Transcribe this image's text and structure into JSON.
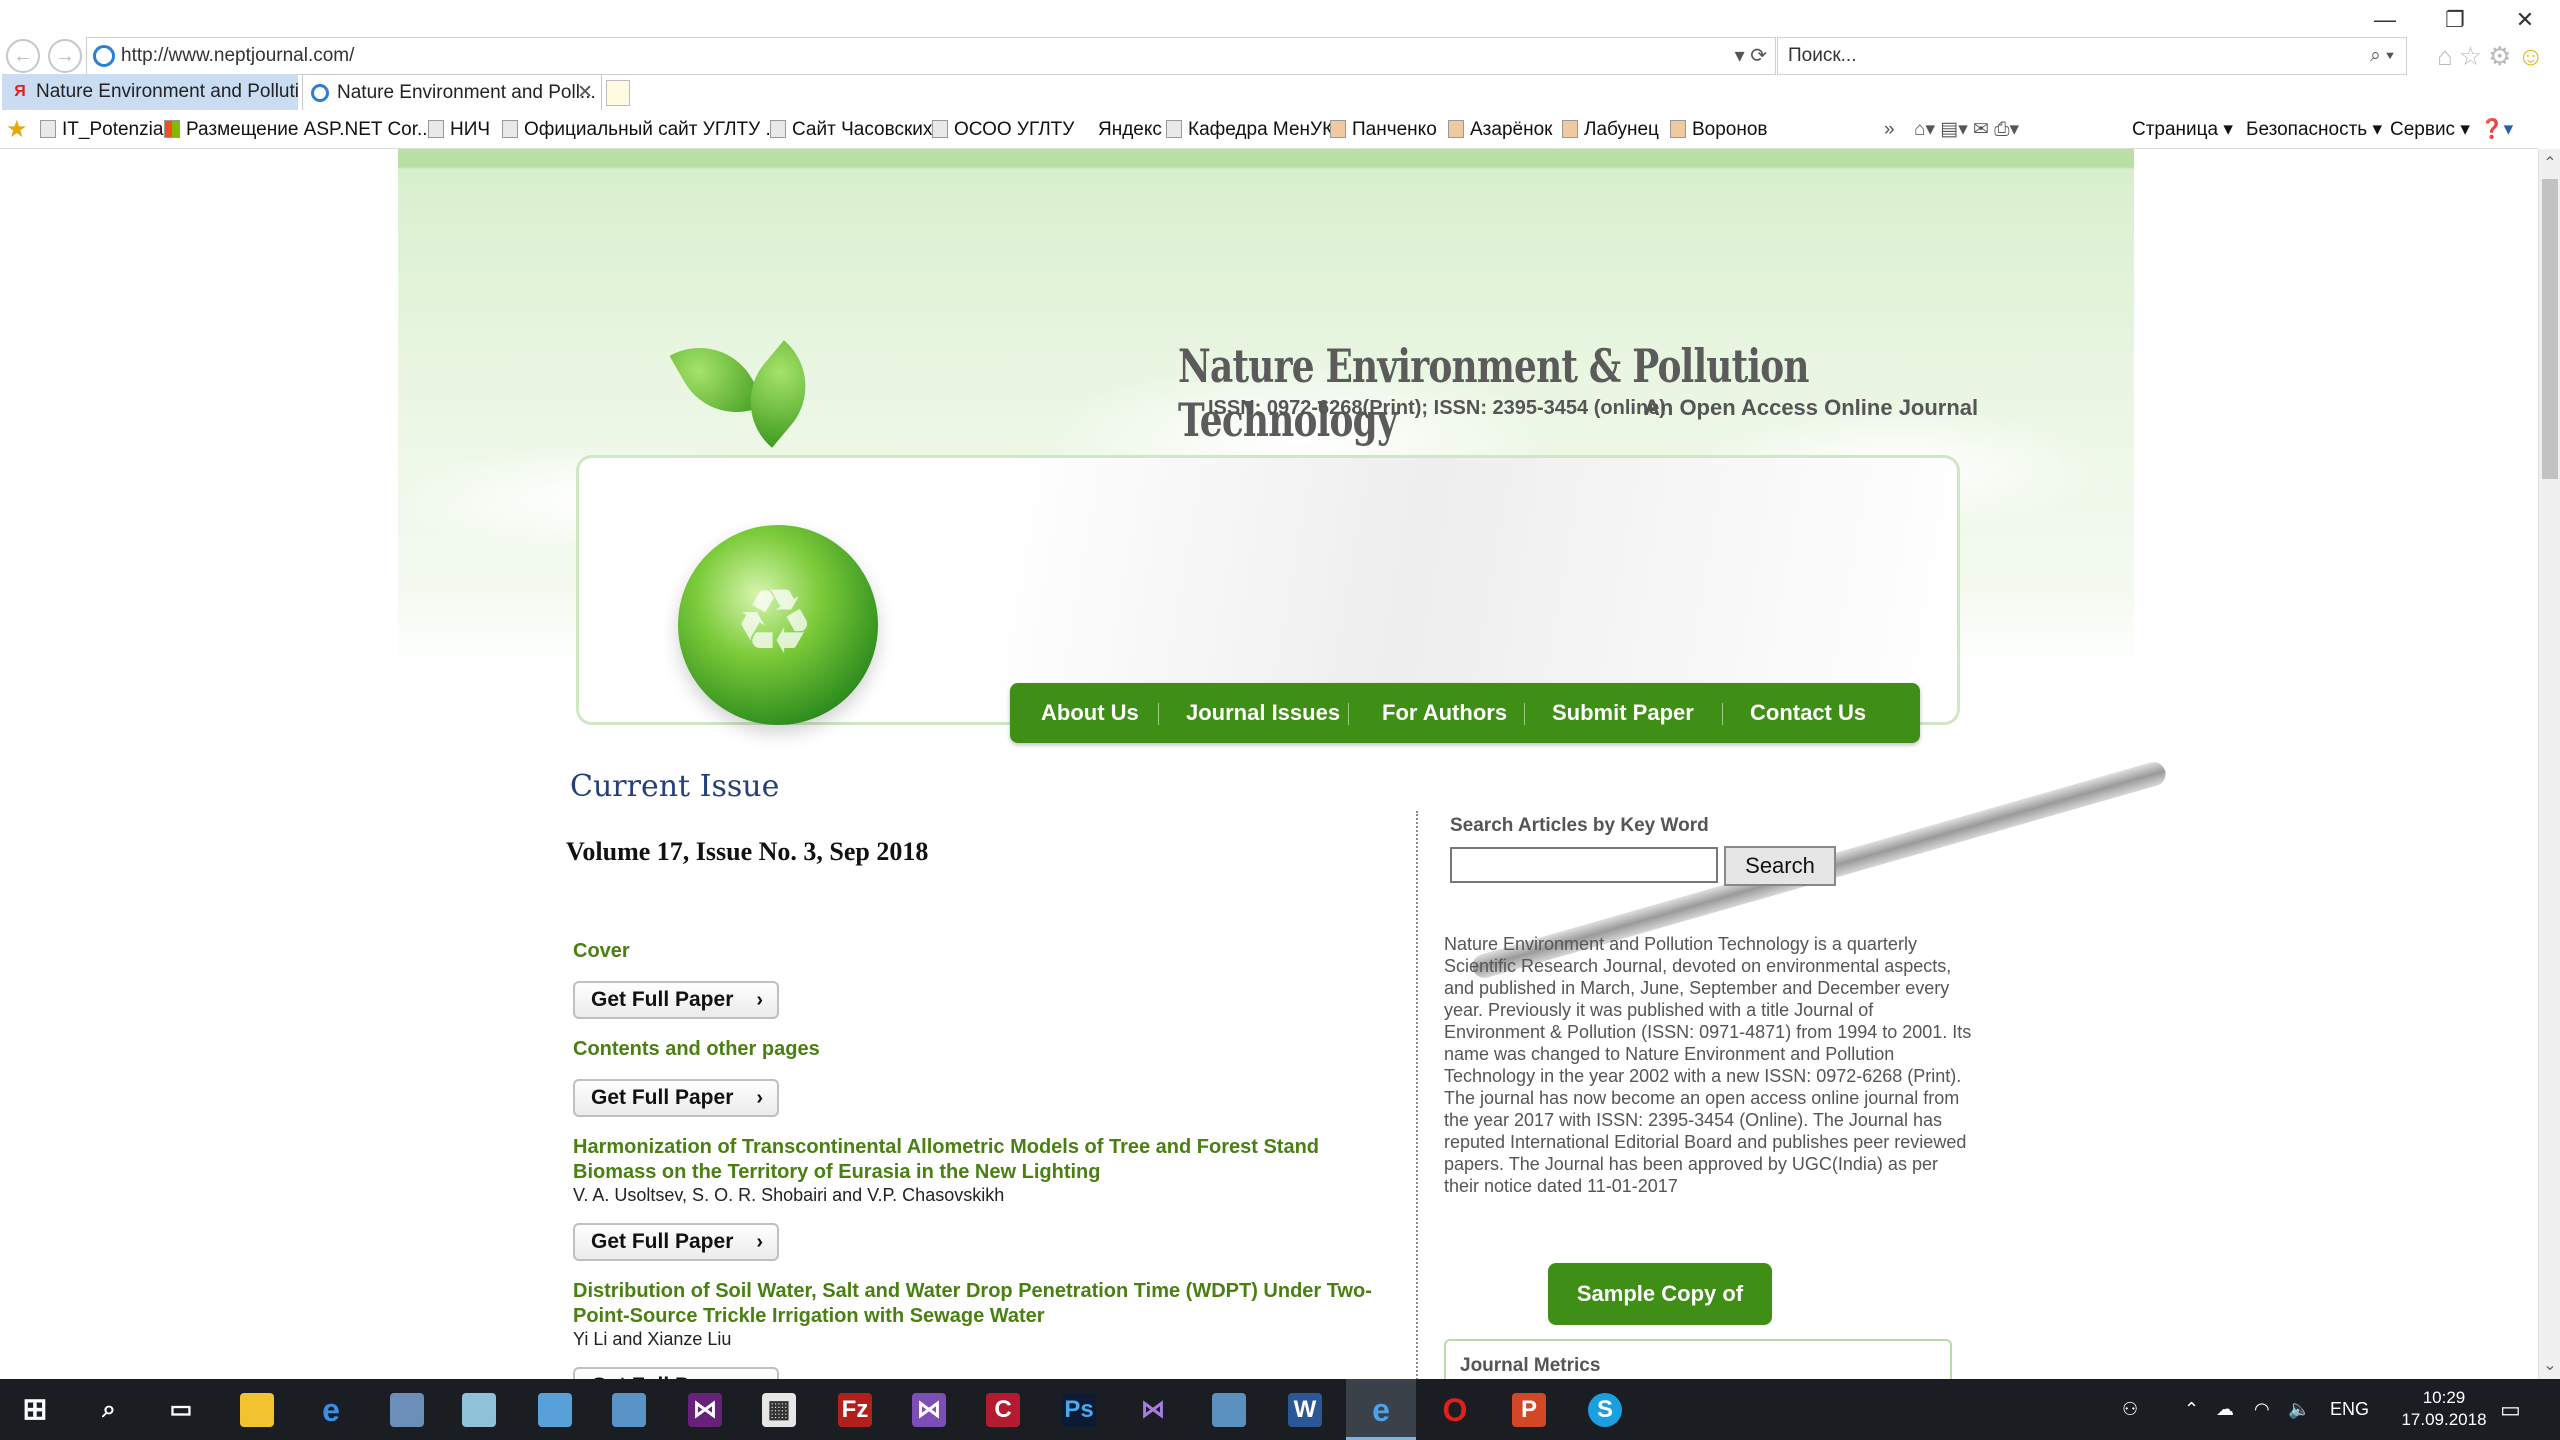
{
  "browser": {
    "url": "http://www.neptjournal.com/",
    "search_placeholder": "Поиск...",
    "tabs": [
      {
        "label": "Nature Environment and Polluti..."
      },
      {
        "label": "Nature Environment and Poll..."
      }
    ],
    "favorites": [
      "IT_Potenzial",
      "Размещение ASP.NET Cor...",
      "НИЧ",
      "Официальный сайт УГЛТУ ...",
      "Сайт Часовских",
      "ОСОО УГЛТУ",
      "Яндекс",
      "Кафедра МенУК",
      "Панченко",
      "Азарёнок",
      "Лабунец",
      "Воронов"
    ],
    "commands": [
      "Страница ▾",
      "Безопасность ▾",
      "Сервис ▾"
    ]
  },
  "site": {
    "title": "Nature  Environment & Pollution Technology",
    "issn": "ISSN: 0972-6268(Print); ISSN: 2395-3454 (online)",
    "tagline": "An Open Access Online Journal",
    "nav": [
      "About Us",
      "Journal Issues",
      "For Authors",
      "Submit Paper",
      "Contact Us"
    ],
    "current_issue_heading": "Current Issue",
    "volume": "Volume 17, Issue No. 3, Sep 2018",
    "full_paper_label": "Get Full Paper",
    "entries": [
      {
        "title": "Cover",
        "authors": ""
      },
      {
        "title": "Contents and other pages",
        "authors": ""
      },
      {
        "title": "Harmonization of Transcontinental Allometric Models of Tree and Forest Stand Biomass on the Territory of Eurasia in the New Lighting",
        "authors": "V. A. Usoltsev, S. O. R. Shobairi and V.P. Chasovskikh"
      },
      {
        "title": "Distribution of Soil Water, Salt and Water Drop Penetration Time (WDPT) Under Two-Point-Source Trickle Irrigation with Sewage Water",
        "authors": "Yi Li and Xianze Liu"
      }
    ],
    "search_label": "Search Articles by Key Word",
    "search_button": "Search",
    "description": "Nature Environment and Pollution Technology is a quarterly Scientific Research Journal, devoted on environmental aspects, and published in March, June, September and December every year. Previously it was published with a title Journal of Environment & Pollution (ISSN: 0971-4871) from 1994 to 2001. Its name was changed to Nature Environment and Pollution Technology in the year 2002 with a new ISSN: 0972-6268 (Print). The journal has now become an open access online journal from the year 2017 with ISSN: 2395-3454 (Online). The Journal has reputed International Editorial Board and publishes peer reviewed papers. The Journal has been approved by UGC(India) as per their notice dated 11-01-2017",
    "sample_button": "Sample Copy of Journal",
    "metrics_heading": "Journal Metrics"
  },
  "taskbar": {
    "lang": "ENG",
    "time": "10:29",
    "date": "17.09.2018"
  }
}
